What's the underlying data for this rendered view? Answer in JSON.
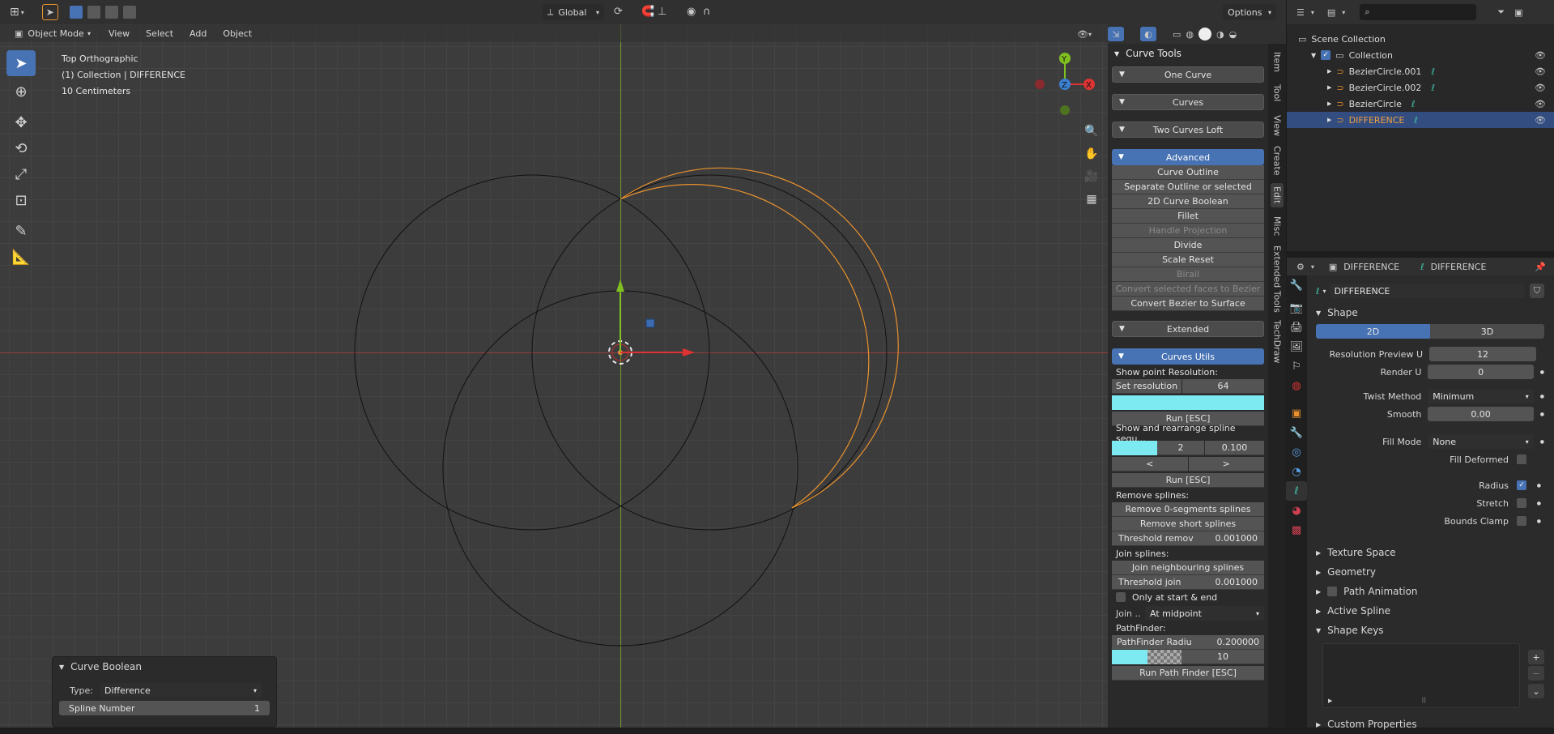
{
  "viewport": {
    "header": {
      "mode": "Object Mode",
      "menus": [
        "View",
        "Select",
        "Add",
        "Object"
      ],
      "orientation": "Global",
      "options": "Options"
    },
    "info": {
      "view": "Top Orthographic",
      "collection": "(1) Collection | DIFFERENCE",
      "scale": "10 Centimeters"
    },
    "gizmo": {
      "y": "Y",
      "z": "Z",
      "x": "X"
    }
  },
  "curve_boolean_panel": {
    "title": "Curve Boolean",
    "type_label": "Type:",
    "type_value": "Difference",
    "spline_label": "Spline Number",
    "spline_value": "1"
  },
  "npanel": {
    "title": "Curve Tools",
    "sections": {
      "one_curve": "One Curve",
      "curves": "Curves",
      "two_curves_loft": "Two Curves Loft",
      "advanced": "Advanced",
      "extended": "Extended",
      "curves_utils": "Curves Utils"
    },
    "advanced_buttons": [
      "Curve Outline",
      "Separate Outline or selected",
      "2D Curve Boolean",
      "Fillet",
      "Handle Projection",
      "Divide",
      "Scale Reset",
      "Birail",
      "Convert selected faces to Bezier",
      "Convert Bezier to Surface"
    ],
    "utils": {
      "show_point_res": "Show point Resolution:",
      "set_resolution": "Set resolution",
      "set_resolution_value": "64",
      "run1": "Run [ESC]",
      "show_rearrange": "Show and rearrange spline sequ...",
      "seq_value1": "2",
      "seq_value2": "0.100",
      "prev": "<",
      "next": ">",
      "run2": "Run [ESC]",
      "remove_splines": "Remove splines:",
      "remove_zero": "Remove 0-segments splines",
      "remove_short": "Remove short splines",
      "threshold_remove": "Threshold remov",
      "threshold_remove_value": "0.001000",
      "join_splines": "Join splines:",
      "join_neighbouring": "Join neighbouring splines",
      "threshold_join": "Threshold join",
      "threshold_join_value": "0.001000",
      "only_start_end": "Only at start & end",
      "join_label": "Join ..",
      "join_value": "At midpoint",
      "pathfinder": "PathFinder:",
      "pathfinder_radius": "PathFinder Radiu",
      "pathfinder_radius_value": "0.200000",
      "pathfinder_value": "10",
      "run_pathfinder": "Run Path Finder [ESC]"
    },
    "tabs": [
      "Item",
      "Tool",
      "View",
      "Create",
      "Edit",
      "Misc",
      "Extended Tools",
      "TechDraw"
    ]
  },
  "outliner": {
    "scene_collection": "Scene Collection",
    "collection": "Collection",
    "items": [
      "BezierCircle.001",
      "BezierCircle.002",
      "BezierCircle",
      "DIFFERENCE"
    ]
  },
  "properties": {
    "object_name": "DIFFERENCE",
    "data_name": "DIFFERENCE",
    "datablock": "DIFFERENCE",
    "shape_section": "Shape",
    "dim_2d": "2D",
    "dim_3d": "3D",
    "res_preview_label": "Resolution Preview U",
    "res_preview_value": "12",
    "render_u_label": "Render U",
    "render_u_value": "0",
    "twist_label": "Twist Method",
    "twist_value": "Minimum",
    "smooth_label": "Smooth",
    "smooth_value": "0.00",
    "fill_mode_label": "Fill Mode",
    "fill_mode_value": "None",
    "fill_deformed": "Fill Deformed",
    "radius": "Radius",
    "stretch": "Stretch",
    "bounds_clamp": "Bounds Clamp",
    "sections": [
      "Texture Space",
      "Geometry",
      "Path Animation",
      "Active Spline",
      "Shape Keys",
      "Custom Properties"
    ]
  },
  "colors": {
    "accent": "#4772b3",
    "selected_curve": "#e8912e",
    "x_axis": "#c8393d",
    "y_axis": "#7fbf20",
    "cyan_field": "#7de9f0"
  }
}
